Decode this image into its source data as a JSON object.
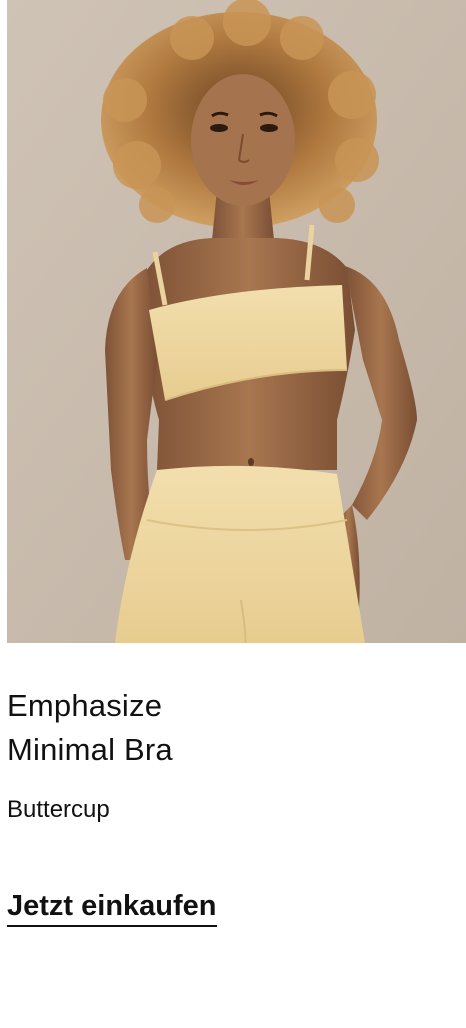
{
  "product": {
    "title_line1": "Emphasize",
    "title_line2": "Minimal Bra",
    "color_name": "Buttercup",
    "cta_label": "Jetzt einkaufen",
    "image_alt": "Model wearing Emphasize Minimal Bra in Buttercup"
  },
  "colors": {
    "background": "#ffffff",
    "image_backdrop": "#c9bcae",
    "garment": "#f0d9a0",
    "skin": "#9c6b4c",
    "hair": "#b8834a",
    "text": "#111111"
  }
}
